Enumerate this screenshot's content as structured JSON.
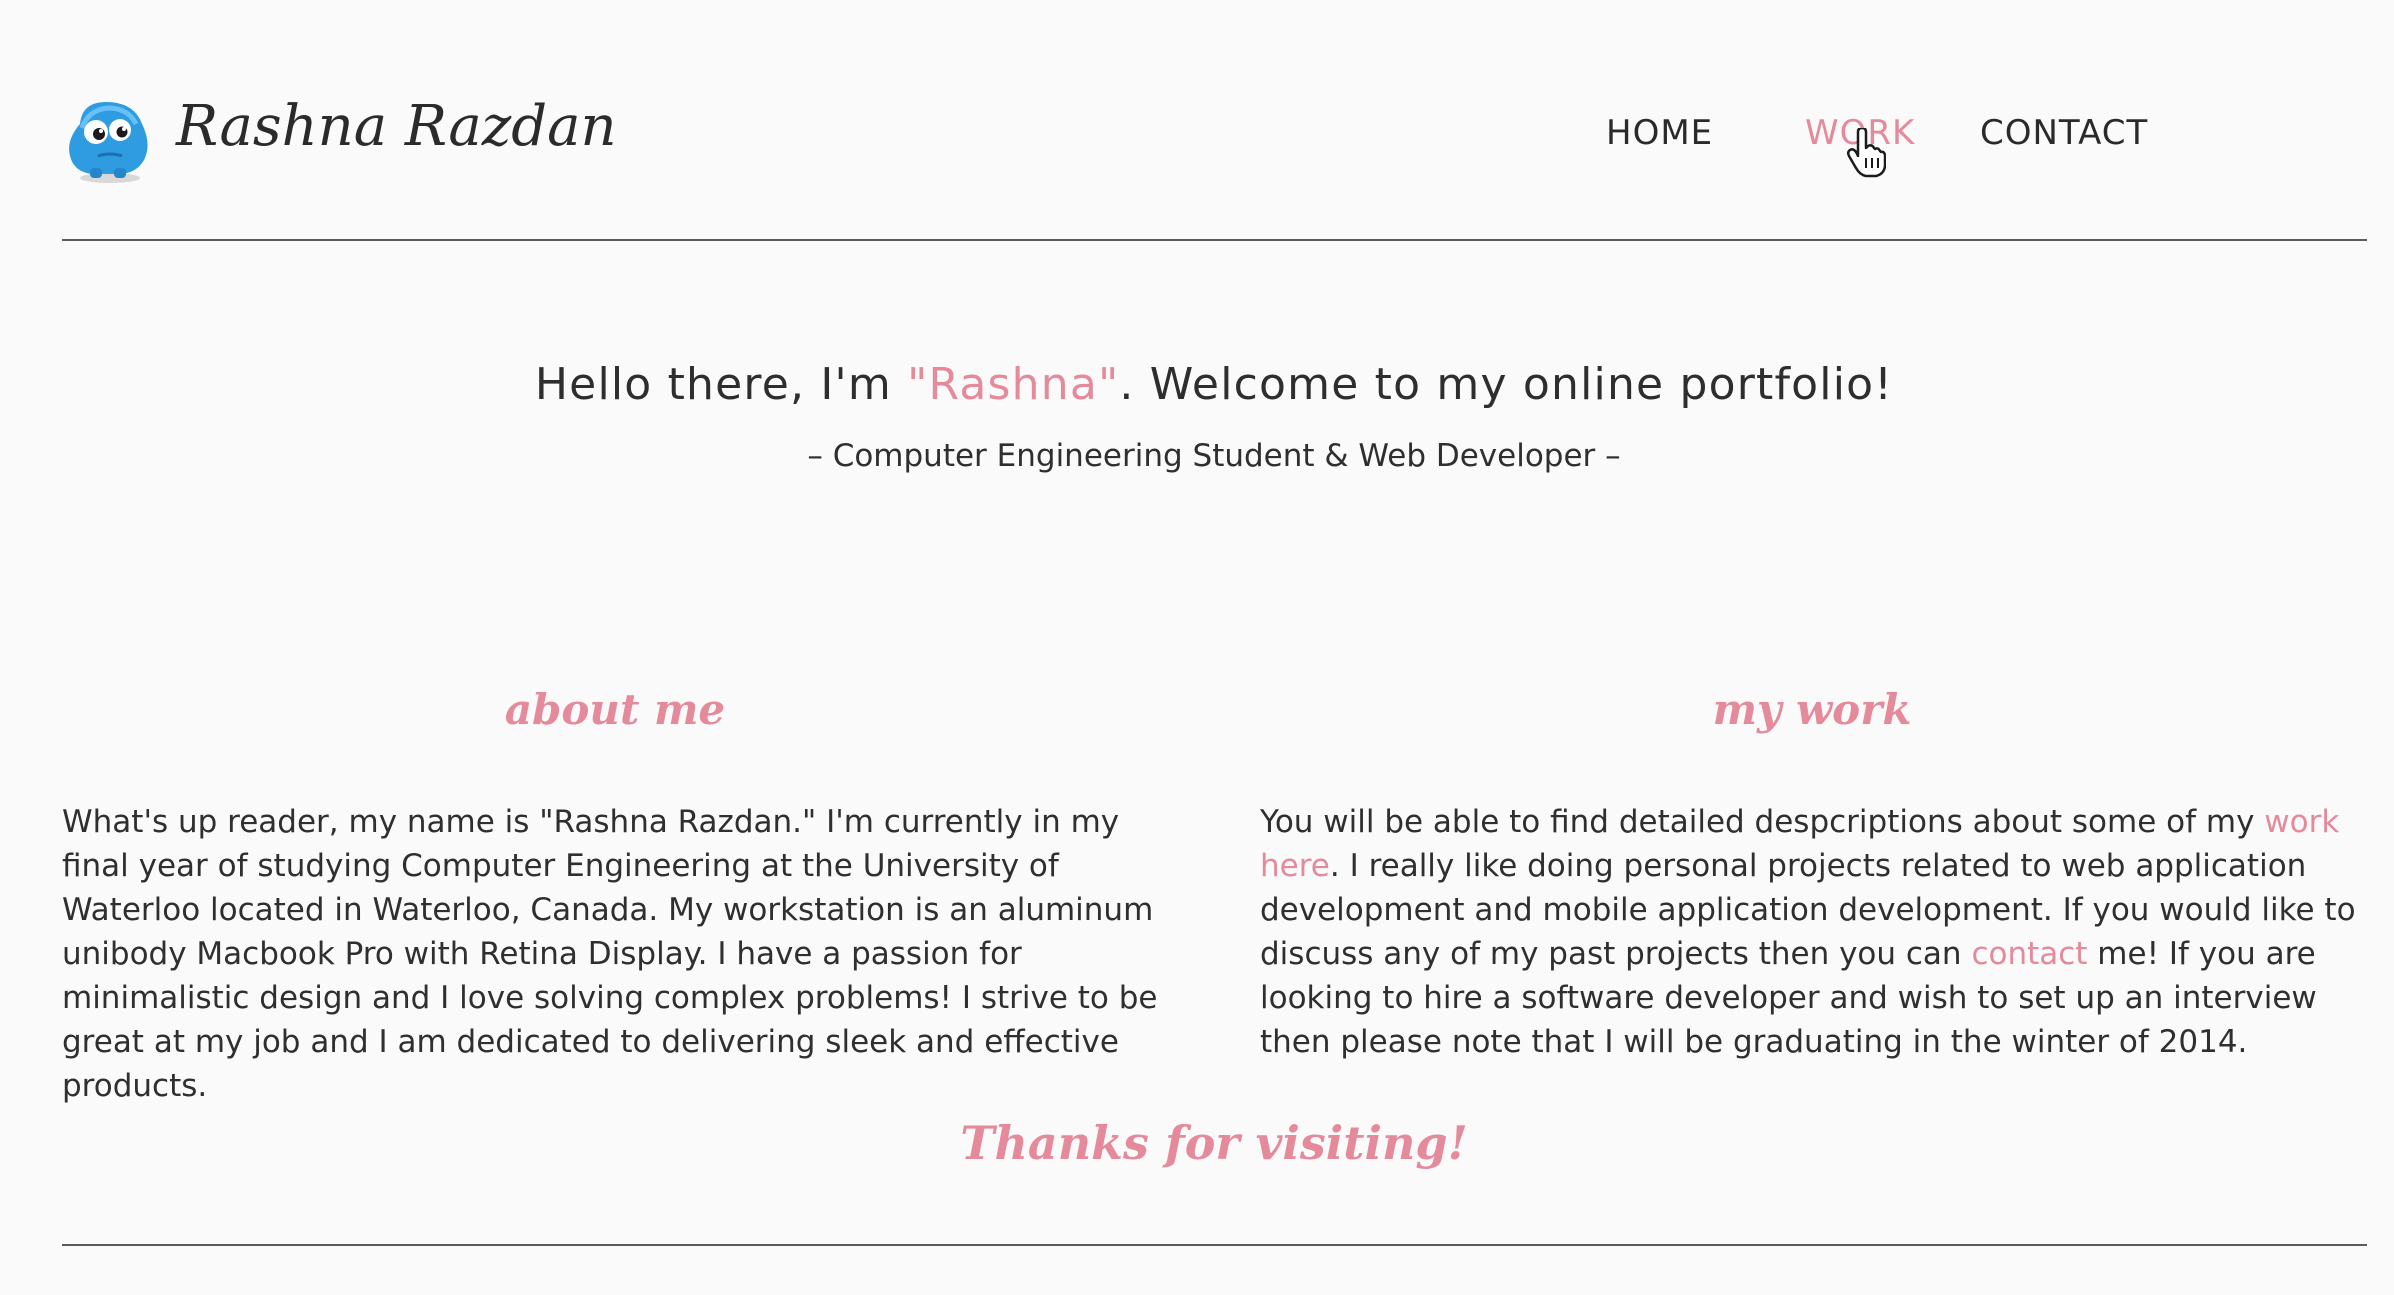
{
  "header": {
    "site_name": "Rashna Razdan",
    "logo_icon": "blue-monster-icon",
    "nav": {
      "home": "HOME",
      "work": "WORK",
      "contact": "CONTACT"
    }
  },
  "hero": {
    "greeting_prefix": "Hello there, I'm ",
    "greeting_name": "\"Rashna\"",
    "greeting_suffix": ". Welcome to my online portfolio!",
    "tagline": "– Computer Engineering Student & Web Developer –"
  },
  "about": {
    "title": "about me",
    "text": "What's up reader, my name is \"Rashna Razdan.\" I'm currently in my final year of studying Computer Engineering at the University of Waterloo located in Waterloo, Canada. My workstation is an aluminum unibody Macbook Pro with Retina Display. I have a passion for minimalistic design and I love solving complex problems! I strive to be great at my job and I am dedicated to delivering sleek and effective products."
  },
  "work": {
    "title": "my work",
    "text_1": "You will be able to find detailed despcriptions about some of my ",
    "link_work": "work here",
    "text_2": ". I really like doing personal projects related to web application development and mobile application development. If you would like to discuss any of my past projects then you can ",
    "link_contact": "contact",
    "text_3": " me! If you are looking to hire a software developer and wish to set up an interview then please note that I will be graduating in the winter of 2014."
  },
  "footer": {
    "thanks": "Thanks for visiting!"
  },
  "colors": {
    "accent": "#e48a9a",
    "text": "#2f2f2f",
    "background": "#fafafa"
  }
}
